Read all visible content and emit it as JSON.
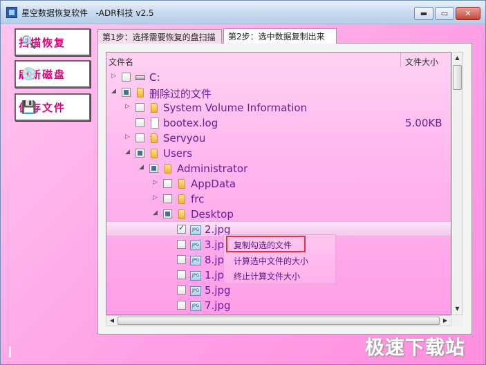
{
  "window": {
    "title": "星空数据恢复软件   -ADR科技 v2.5",
    "min_label": "▬",
    "max_label": "▭",
    "close_label": "✕"
  },
  "sidebar": {
    "scan_label": "扫描恢复",
    "refresh_label": "刷新磁盘",
    "save_label": "保存文件"
  },
  "tabs": [
    {
      "label": "第1步：选择需要恢复的盘扫描"
    },
    {
      "label": "第2步：选中数据复制出来"
    }
  ],
  "tree": {
    "header": {
      "name": "文件名",
      "size": "文件大小"
    },
    "rows": [
      {
        "name": "C:",
        "size": ""
      },
      {
        "name": "删除过的文件",
        "size": ""
      },
      {
        "name": "System Volume Information",
        "size": ""
      },
      {
        "name": "bootex.log",
        "size": "5.00KB"
      },
      {
        "name": "Servyou",
        "size": ""
      },
      {
        "name": "Users",
        "size": ""
      },
      {
        "name": "Administrator",
        "size": ""
      },
      {
        "name": "AppData",
        "size": ""
      },
      {
        "name": "frc",
        "size": ""
      },
      {
        "name": "Desktop",
        "size": ""
      },
      {
        "name": "2.jpg",
        "size": ""
      },
      {
        "name": "3.jpg",
        "size": ""
      },
      {
        "name": "8.jpg",
        "size": ""
      },
      {
        "name": "1.jpg",
        "size": ""
      },
      {
        "name": "5.jpg",
        "size": ""
      },
      {
        "name": "7.jpg",
        "size": ""
      }
    ]
  },
  "context_menu": {
    "items": [
      "复制勾选的文件",
      "计算选中文件的大小",
      "终止计算文件大小"
    ]
  },
  "watermark": "极速下载站"
}
